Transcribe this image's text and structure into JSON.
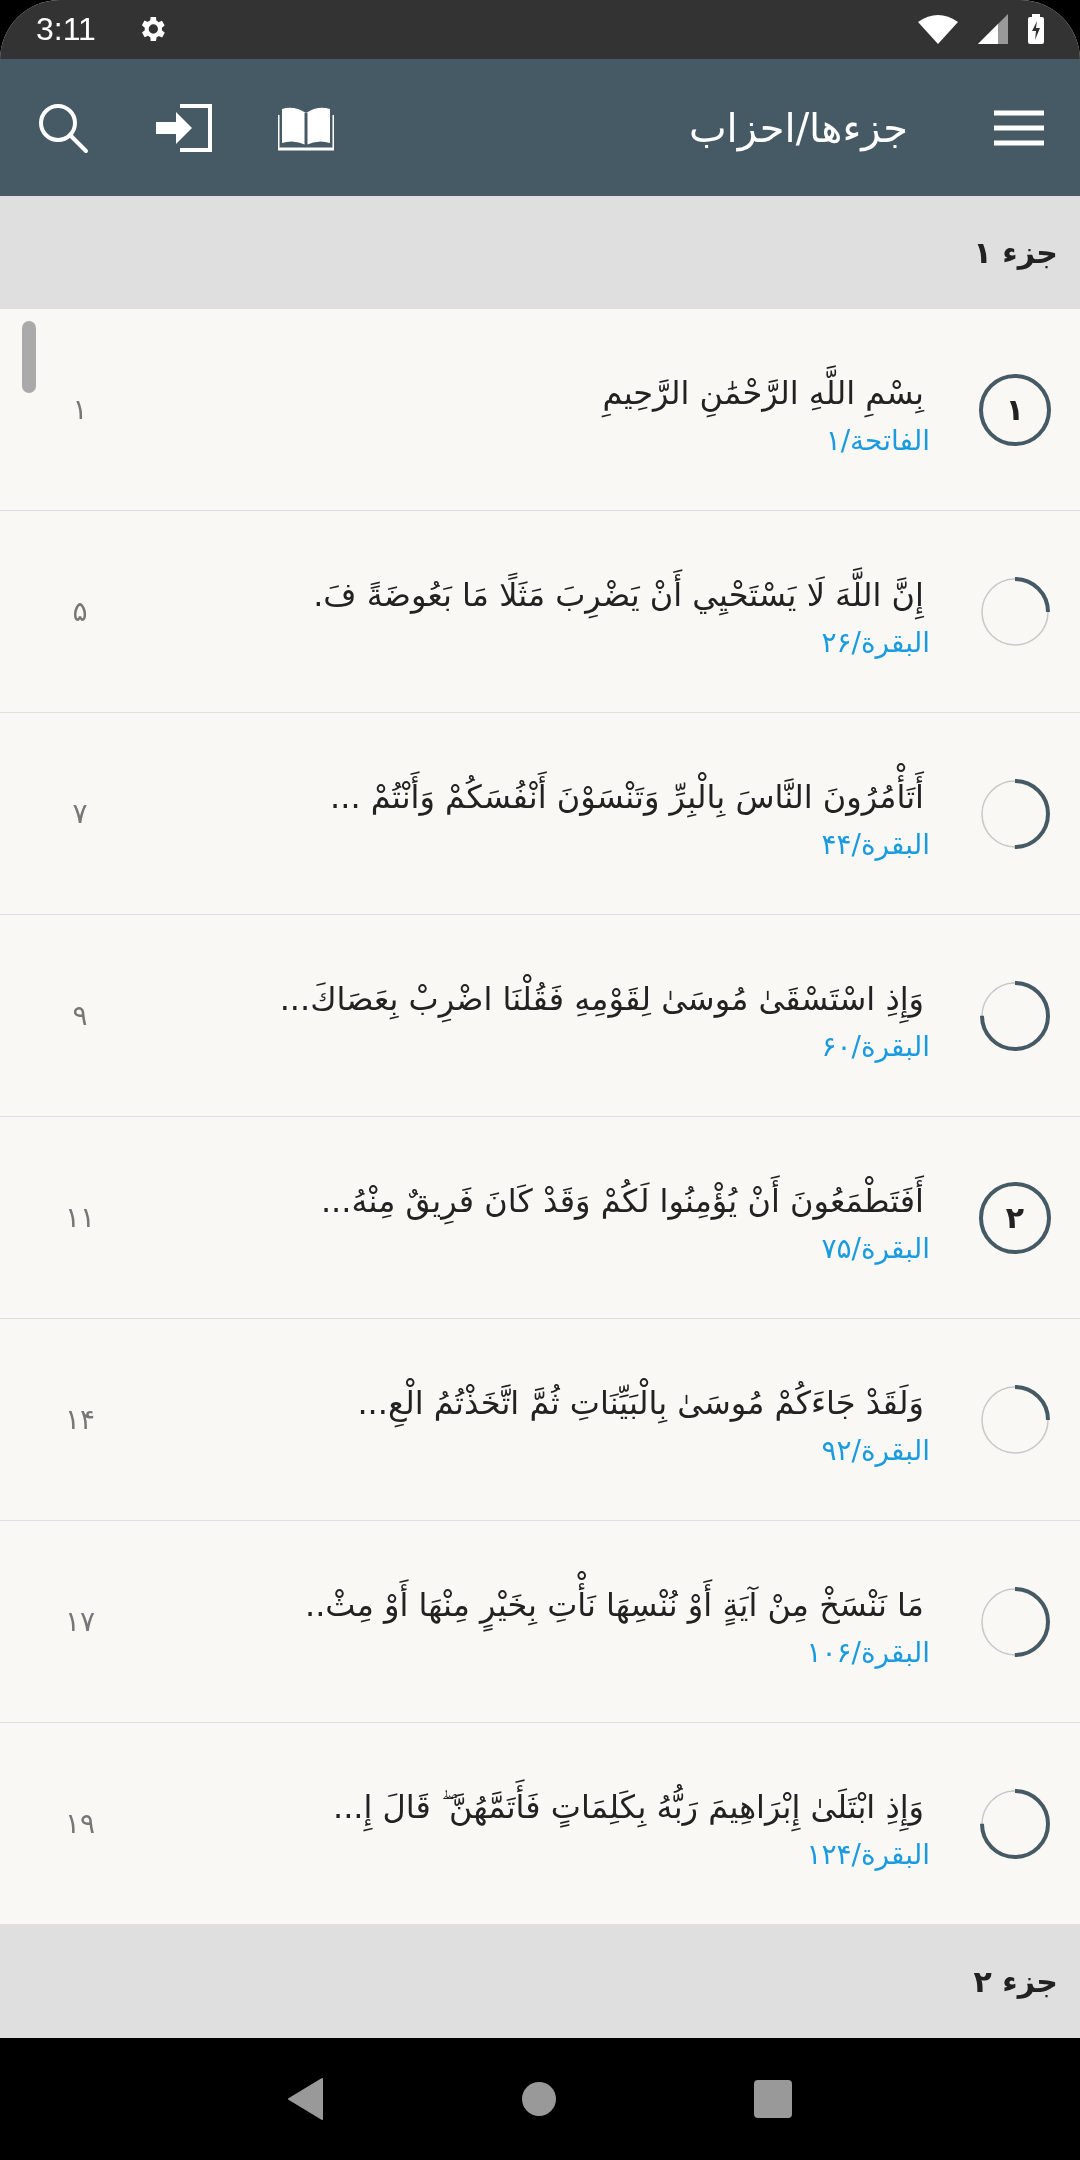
{
  "status_bar": {
    "time": "3:11"
  },
  "app_bar": {
    "title": "جزءها/احزاب"
  },
  "sections": [
    {
      "title": "جزء ۱",
      "items": [
        {
          "text": "بِسْمِ اللَّهِ الرَّحْمَٰنِ الرَّحِيمِ",
          "ref": "الفاتحة/۱",
          "page": "۱",
          "marker": {
            "kind": "badge",
            "label": "۱"
          }
        },
        {
          "text": "إِنَّ اللَّهَ لَا يَسْتَحْيِي أَنْ يَضْرِبَ مَثَلًا مَا بَعُوضَةً فَ.",
          "ref": "البقرة/۲۶",
          "page": "۵",
          "marker": {
            "kind": "progress",
            "level": 0.25
          }
        },
        {
          "text": "أَتَأْمُرُونَ النَّاسَ بِالْبِرِّ وَتَنْسَوْنَ أَنْفُسَكُمْ وَأَنْتُمْ ...",
          "ref": "البقرة/۴۴",
          "page": "۷",
          "marker": {
            "kind": "progress",
            "level": 0.5
          }
        },
        {
          "text": "وَإِذِ اسْتَسْقَىٰ مُوسَىٰ لِقَوْمِهِ فَقُلْنَا اضْرِبْ بِعَصَاكَ...",
          "ref": "البقرة/۶۰",
          "page": "۹",
          "marker": {
            "kind": "progress",
            "level": 0.75
          }
        },
        {
          "text": "أَفَتَطْمَعُونَ أَنْ يُؤْمِنُوا لَكُمْ وَقَدْ كَانَ فَرِيقٌ مِنْهُ...",
          "ref": "البقرة/۷۵",
          "page": "۱۱",
          "marker": {
            "kind": "badge",
            "label": "۲"
          }
        },
        {
          "text": "وَلَقَدْ جَاءَكُمْ مُوسَىٰ بِالْبَيِّنَاتِ ثُمَّ اتَّخَذْتُمُ الْعِ...",
          "ref": "البقرة/۹۲",
          "page": "۱۴",
          "marker": {
            "kind": "progress",
            "level": 0.25
          }
        },
        {
          "text": "مَا نَنْسَخْ مِنْ آيَةٍ أَوْ نُنْسِهَا نَأْتِ بِخَيْرٍ مِنْهَا أَوْ مِثْ..",
          "ref": "البقرة/۱۰۶",
          "page": "۱۷",
          "marker": {
            "kind": "progress",
            "level": 0.5
          }
        },
        {
          "text": "وَإِذِ ابْتَلَىٰ إِبْرَاهِيمَ رَبُّهُ بِكَلِمَاتٍ فَأَتَمَّهُنَّ ۖ قَالَ إِ...",
          "ref": "البقرة/۱۲۴",
          "page": "۱۹",
          "marker": {
            "kind": "progress",
            "level": 0.75
          }
        }
      ]
    },
    {
      "title": "جزء ۲"
    }
  ]
}
